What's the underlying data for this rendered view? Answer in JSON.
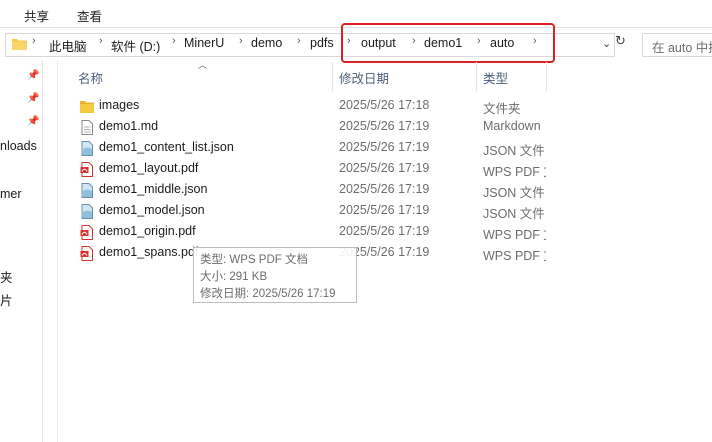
{
  "ribbon": {
    "tabs": [
      "共享",
      "查看"
    ]
  },
  "address": {
    "segments": [
      "此电脑",
      "软件 (D:)",
      "MinerU",
      "demo",
      "pdfs",
      "output",
      "demo1",
      "auto"
    ]
  },
  "search": {
    "placeholder": "在 auto 中搜"
  },
  "nav": {
    "items": [
      "nloads",
      "mer",
      "夹",
      "片"
    ]
  },
  "columns": {
    "name": "名称",
    "date": "修改日期",
    "type": "类型"
  },
  "files": [
    {
      "name": "images",
      "date": "2025/5/26 17:18",
      "type": "文件夹",
      "icon": "folder-icon"
    },
    {
      "name": "demo1.md",
      "date": "2025/5/26 17:19",
      "type": "Markdown",
      "icon": "file-icon"
    },
    {
      "name": "demo1_content_list.json",
      "date": "2025/5/26 17:19",
      "type": "JSON 文件",
      "icon": "json-icon"
    },
    {
      "name": "demo1_layout.pdf",
      "date": "2025/5/26 17:19",
      "type": "WPS PDF 文",
      "icon": "pdf-icon"
    },
    {
      "name": "demo1_middle.json",
      "date": "2025/5/26 17:19",
      "type": "JSON 文件",
      "icon": "json-icon"
    },
    {
      "name": "demo1_model.json",
      "date": "2025/5/26 17:19",
      "type": "JSON 文件",
      "icon": "json-icon"
    },
    {
      "name": "demo1_origin.pdf",
      "date": "2025/5/26 17:19",
      "type": "WPS PDF 文",
      "icon": "pdf-icon"
    },
    {
      "name": "demo1_spans.pdf",
      "date": "2025/5/26 17:19",
      "type": "WPS PDF 文",
      "icon": "pdf-icon"
    }
  ],
  "tooltip": {
    "type": "类型: WPS PDF 文档",
    "size": "大小: 291 KB",
    "modified": "修改日期: 2025/5/26 17:19"
  },
  "colors": {
    "highlight": "#e02020",
    "header": "#4c607a",
    "folder": "#f5c842",
    "pdf": "#d9342b"
  }
}
